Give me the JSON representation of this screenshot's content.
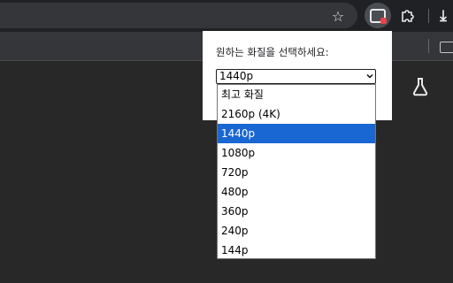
{
  "popup": {
    "prompt": "원하는 화질을 선택하세요:",
    "selected_value": "1440p"
  },
  "quality_options": [
    {
      "label": "최고 화질",
      "selected": false
    },
    {
      "label": "2160p (4K)",
      "selected": false
    },
    {
      "label": "1440p",
      "selected": true
    },
    {
      "label": "1080p",
      "selected": false
    },
    {
      "label": "720p",
      "selected": false
    },
    {
      "label": "480p",
      "selected": false
    },
    {
      "label": "360p",
      "selected": false
    },
    {
      "label": "240p",
      "selected": false
    },
    {
      "label": "144p",
      "selected": false
    }
  ],
  "toolbar": {
    "icons": [
      "bookmark-star-icon",
      "quality-extension-icon",
      "extensions-puzzle-icon",
      "download-icon",
      "bookmark-folder-icon",
      "labs-flask-icon"
    ]
  },
  "colors": {
    "highlight": "#1967d2",
    "page_background": "#282828",
    "toolbar_background": "#202124"
  }
}
